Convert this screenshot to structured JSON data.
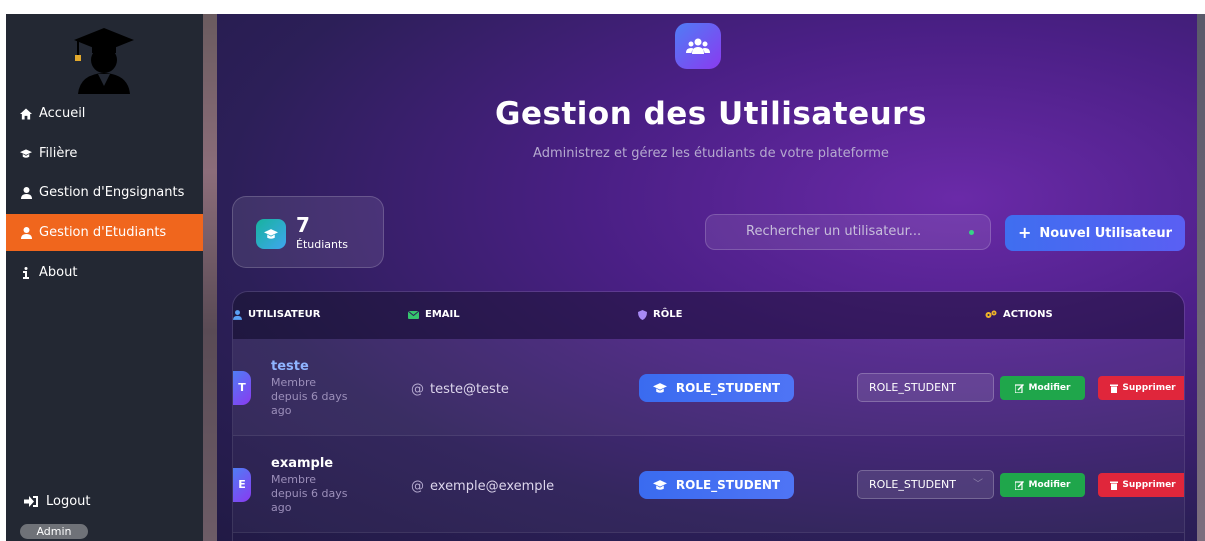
{
  "sidebar": {
    "items": [
      {
        "label": "Accueil",
        "icon": "home-icon"
      },
      {
        "label": "Filière",
        "icon": "graduation-cap-icon"
      },
      {
        "label": "Gestion d'Engsignants",
        "icon": "user-icon"
      },
      {
        "label": "Gestion d'Etudiants",
        "icon": "user-icon",
        "active": true
      },
      {
        "label": "About",
        "icon": "info-icon"
      }
    ],
    "logout_label": "Logout",
    "role_badge": "Admin"
  },
  "header": {
    "title": "Gestion des Utilisateurs",
    "subtitle": "Administrez et gérez les étudiants de votre plateforme"
  },
  "stats": {
    "count": "7",
    "label": "Étudiants"
  },
  "search": {
    "placeholder": "Rechercher un utilisateur..."
  },
  "new_user_button": "Nouvel Utilisateur",
  "table": {
    "headers": {
      "user": "UTILISATEUR",
      "email": "EMAIL",
      "role": "RÔLE",
      "actions": "ACTIONS"
    },
    "rows": [
      {
        "initial": "T",
        "name": "teste",
        "member_since": "Membre depuis 6 days ago",
        "email": "teste@teste",
        "role": "ROLE_STUDENT",
        "role_select": "ROLE_STUDENT",
        "edit": "Modifier",
        "delete": "Supprimer"
      },
      {
        "initial": "E",
        "name": "example",
        "member_since": "Membre depuis 6 days ago",
        "email": "exemple@exemple",
        "role": "ROLE_STUDENT",
        "role_select": "ROLE_STUDENT",
        "edit": "Modifier",
        "delete": "Supprimer"
      }
    ]
  },
  "colors": {
    "sidebar_bg": "#232833",
    "active_item": "#f0661d",
    "primary_button": "#3f6ef0",
    "edit_button": "#1fa64b",
    "delete_button": "#e0263b"
  }
}
